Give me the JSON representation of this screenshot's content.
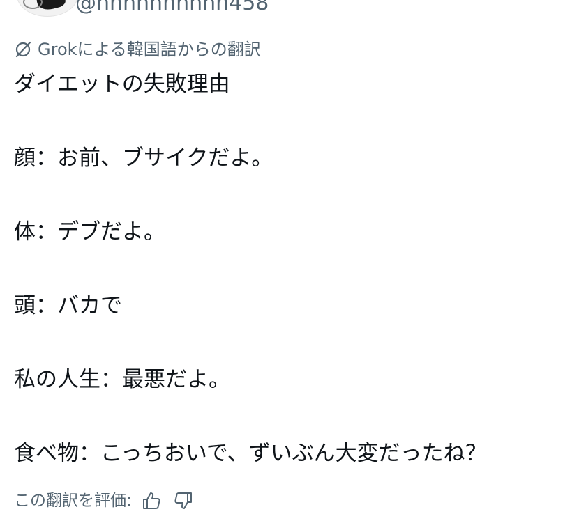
{
  "author": {
    "handle": "@hhhhhhhhhh458"
  },
  "translation": {
    "attribution": "Grokによる韓国語からの翻訳",
    "attribution_icon": "grok-icon"
  },
  "post": {
    "lines": [
      "ダイエットの失敗理由",
      "顔：お前、ブサイクだよ。",
      "体：デブだよ。",
      "頭：バカで",
      "私の人生：最悪だよ。",
      "食べ物：こっちおいで、ずいぶん大変だったね？"
    ]
  },
  "rating": {
    "label": "この翻訳を評価:",
    "thumbs_up_icon": "thumbs-up-icon",
    "thumbs_down_icon": "thumbs-down-icon"
  },
  "colors": {
    "text_primary": "#0f1419",
    "text_secondary": "#536471"
  }
}
